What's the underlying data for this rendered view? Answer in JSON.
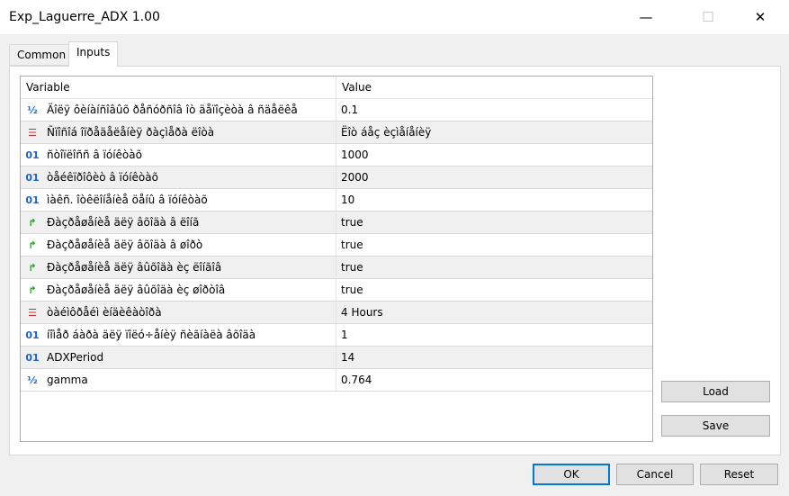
{
  "window": {
    "title": "Exp_Laguerre_ADX 1.00",
    "minimize": "—",
    "maximize": "☐",
    "close": "✕"
  },
  "tabs": [
    {
      "label": "Common"
    },
    {
      "label": "Inputs"
    }
  ],
  "grid": {
    "col_variable": "Variable",
    "col_value": "Value",
    "rows": [
      {
        "icon": "half",
        "name": "Äîëÿ ôèíàíñîâûõ ðåñóðñîâ îò äåïîçèòà â ñäåëêå",
        "value": "0.1"
      },
      {
        "icon": "enum",
        "name": "Ñïîñîá îïðåäåëåíèÿ ðàçìåðà ëîòà",
        "value": "Ëîò áåç èçìåíåíèÿ"
      },
      {
        "icon": "int",
        "name": "ñòîïëîññ â ïóíêòàõ",
        "value": "1000"
      },
      {
        "icon": "int",
        "name": "òåéêïðîôèò â ïóíêòàõ",
        "value": "2000"
      },
      {
        "icon": "int",
        "name": "ìàêñ. îòêëîíåíèå öåíû â ïóíêòàõ",
        "value": "10"
      },
      {
        "icon": "bool",
        "name": "Ðàçðåøåíèå äëÿ âõîäà â ëîíã",
        "value": "true"
      },
      {
        "icon": "bool",
        "name": "Ðàçðåøåíèå äëÿ âõîäà â øîðò",
        "value": "true"
      },
      {
        "icon": "bool",
        "name": "Ðàçðåøåíèå äëÿ âûõîäà èç ëîíãîâ",
        "value": "true"
      },
      {
        "icon": "bool",
        "name": "Ðàçðåøåíèå äëÿ âûõîäà èç øîðòîâ",
        "value": "true"
      },
      {
        "icon": "enum",
        "name": "òàéìôðåéì èíäèêàòîðà",
        "value": "4 Hours"
      },
      {
        "icon": "int",
        "name": "íîìåð áàðà äëÿ ïîëó÷åíèÿ ñèãíàëà âõîäà",
        "value": "1"
      },
      {
        "icon": "int",
        "name": "ADXPeriod",
        "value": "14"
      },
      {
        "icon": "half",
        "name": "gamma",
        "value": "0.764"
      }
    ]
  },
  "side_buttons": {
    "load": "Load",
    "save": "Save"
  },
  "footer": {
    "ok": "OK",
    "cancel": "Cancel",
    "reset": "Reset"
  }
}
